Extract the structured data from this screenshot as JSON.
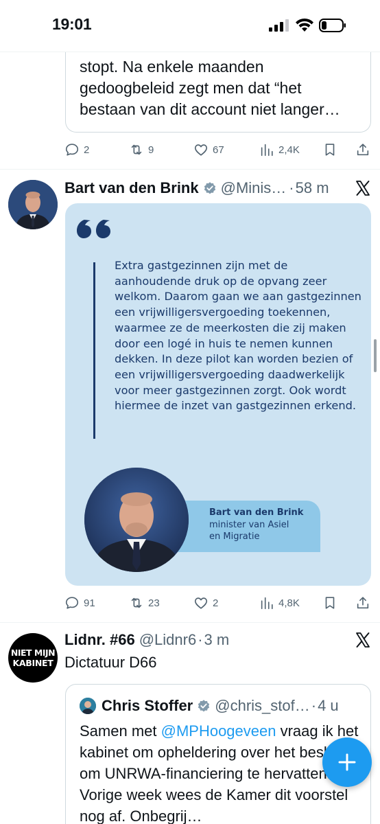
{
  "status_bar": {
    "time": "19:01"
  },
  "tweet1": {
    "quote_text": "stopt. Na enkele maanden gedoogbeleid zegt men dat “het bestaan van dit account niet langer…",
    "stats": {
      "replies": "2",
      "reposts": "9",
      "likes": "67",
      "views": "2,4K"
    }
  },
  "tweet2": {
    "author_name": "Bart van den Brink",
    "handle": "@Minis…",
    "time": "58 m",
    "card": {
      "quote_text": "Extra gastgezinnen zijn met de aanhoudende druk op de opvang zeer welkom. Daarom gaan we aan gastgezinnen een vrijwilligersvergoeding toekennen, waarmee ze de meerkosten die zij maken door een logé in huis te nemen kunnen dekken. In deze pilot kan worden bezien of een vrijwilligersvergoeding daadwerkelijk voor meer gastgezinnen zorgt. Ook wordt hiermee de inzet van gastgezinnen erkend.",
      "person_name": "Bart van den Brink",
      "person_role_line1": "minister van Asiel",
      "person_role_line2": "en Migratie",
      "bg_color": "#cde3f2",
      "text_color": "#1b3a6b"
    },
    "stats": {
      "replies": "91",
      "reposts": "23",
      "likes": "2",
      "views": "4,8K"
    }
  },
  "tweet3": {
    "author_name": "Lidnr. #66",
    "handle": "@Lidnr6",
    "time": "3 m",
    "avatar_text_line1": "NIET MIJN",
    "avatar_text_line2": "KABINET",
    "text": "Dictatuur D66",
    "quote": {
      "author_name": "Chris Stoffer",
      "handle": "@chris_stof…",
      "time": "4 u",
      "text_before_link": "Samen met ",
      "link_text": "@MPHoogeveen",
      "text_after_link": " vraag ik het kabinet om opheldering over het besluit om UNRWA-financiering te hervatten. Vorige week wees de Kamer dit voorstel nog af. Onbegrij…"
    }
  },
  "icons": {
    "reply": "reply-icon",
    "repost": "repost-icon",
    "like": "like-icon",
    "views": "views-icon",
    "bookmark": "bookmark-icon",
    "share": "share-icon",
    "verified": "verified-badge-icon",
    "x": "x-logo-icon",
    "compose": "compose-plus-icon"
  },
  "colors": {
    "accent": "#1d9bf0",
    "secondary_text": "#536471"
  }
}
